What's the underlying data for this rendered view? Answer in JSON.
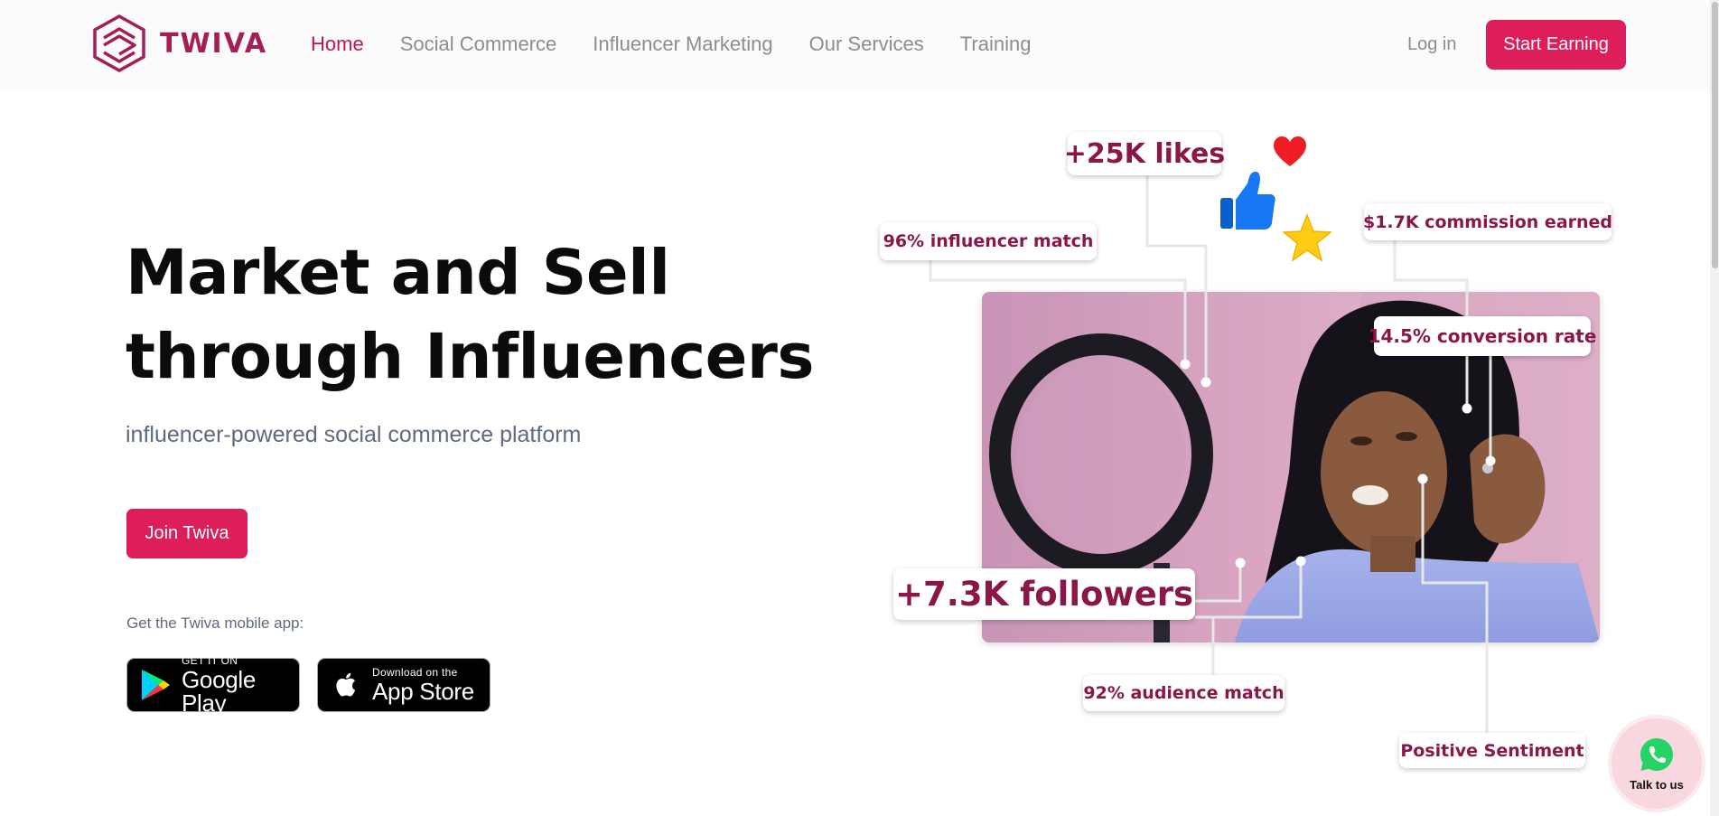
{
  "nav": {
    "brand": "TWIVA",
    "links": [
      {
        "label": "Home",
        "active": true
      },
      {
        "label": "Social Commerce",
        "active": false
      },
      {
        "label": "Influencer Marketing",
        "active": false
      },
      {
        "label": "Our Services",
        "active": false
      },
      {
        "label": "Training",
        "active": false
      }
    ],
    "login": "Log in",
    "cta": "Start Earning"
  },
  "hero": {
    "headline": "Market and Sell through Influencers",
    "subtitle": "influencer-powered social commerce platform",
    "join_button": "Join Twiva",
    "app_label": "Get the Twiva mobile app:",
    "google_play": {
      "small": "GET IT ON",
      "big": "Google Play",
      "icon": "google-play-icon"
    },
    "app_store": {
      "small": "Download on the",
      "big": "App Store",
      "icon": "apple-icon"
    }
  },
  "stats": {
    "likes": "+25K likes",
    "influencer_match": "96% influencer match",
    "commission": "$1.7K commission earned",
    "conversion": "14.5% conversion rate",
    "followers": "+7.3K followers",
    "audience_match": "92% audience match",
    "sentiment": "Positive Sentiment"
  },
  "chat": {
    "label": "Talk to us",
    "icon": "whatsapp-icon"
  },
  "colors": {
    "brand": "#dd1e5a",
    "brand_dark": "#a41e57",
    "stat_text": "#8a1747",
    "nav_text": "#8d8d8d"
  }
}
